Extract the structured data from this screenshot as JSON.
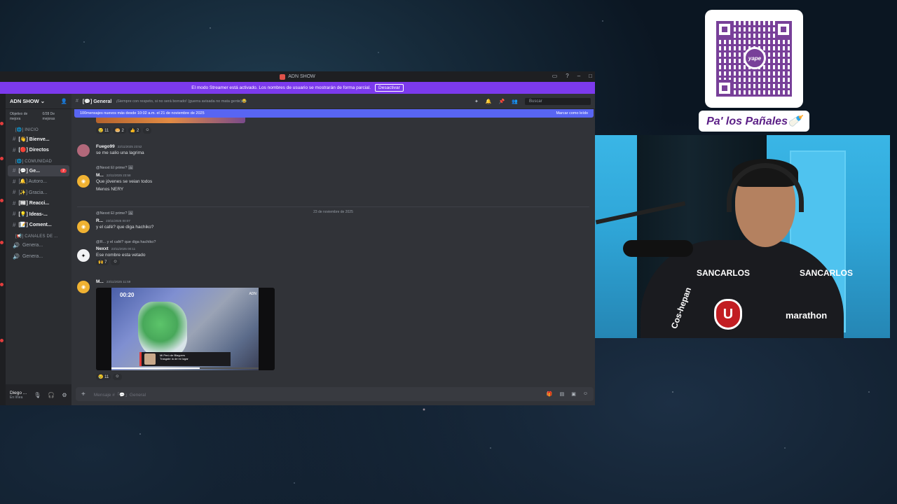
{
  "window": {
    "title": "ADN SHOW",
    "streamer_notice": "El modo Streamer está activado. Los nombres de usuario se mostrarán de forma parcial.",
    "streamer_button": "Desactivar"
  },
  "server": {
    "name": "ADN SHOW",
    "boost_label": "Objetivo de mejora",
    "boost_progress": "0/28 De mejoras"
  },
  "channels": [
    {
      "type": "category",
      "label": "[🌐] INICIO"
    },
    {
      "type": "channel",
      "label": "[👋] Bienve...",
      "bold": true
    },
    {
      "type": "channel",
      "label": "[🔴] Directos",
      "bold": true
    },
    {
      "type": "category",
      "label": "[🌐] COMUNIDAD"
    },
    {
      "type": "channel",
      "label": "[💬] Ge...",
      "active": true,
      "badge": "2"
    },
    {
      "type": "channel",
      "label": "[🔔] Autoro..."
    },
    {
      "type": "channel",
      "label": "[✨] Gracia..."
    },
    {
      "type": "channel",
      "label": "[📰] Reacci...",
      "bold": true
    },
    {
      "type": "channel",
      "label": "[💡] Ideas-...",
      "bold": true
    },
    {
      "type": "channel",
      "label": "[📝] Coment...",
      "bold": true
    },
    {
      "type": "category",
      "label": "[📢] CANALES DE ..."
    },
    {
      "type": "voice",
      "label": "Genera..."
    },
    {
      "type": "voice",
      "label": "Genera..."
    }
  ],
  "user": {
    "name": "Diego ...",
    "status": "En línea"
  },
  "chat": {
    "channel_name": "[💬] General",
    "topic": "¡Siempre con respeto, si no será borrado! (guerra avisada no mata gente)😂",
    "search_placeholder": "Buscar",
    "new_messages": "100mensajes nuevos más desde 10:02 a.m. el 21 de noviembre de 2025",
    "mark_read": "Marcar como leído",
    "composer_placeholder": "Mensaje #「💬」General",
    "date_divider": "23 de noviembre de 2025"
  },
  "messages": {
    "top_reacts": [
      "😢 11",
      "🥯 2",
      "👍 2",
      "☺"
    ],
    "m1": {
      "author": "Fuego99",
      "time": "22/11/2025 23:52",
      "text": "se me salio una lagrima"
    },
    "m2": {
      "reply": "@Nexxt El prime? 🖼",
      "author": "M...",
      "time": "22/11/2025 23:58",
      "line1": "Que jóvenes se veian todos",
      "line2": "Menos NERY"
    },
    "m3": {
      "reply": "@Nexxt El prime? 🖼",
      "author": "R...",
      "time": "23/11/2025 00:07",
      "text": "y el café? que diga hachiko?"
    },
    "m4": {
      "reply": "@R... y el café? que diga hachiko?",
      "author": "Nexxt",
      "time": "23/11/2025 00:11",
      "text": "Ese nombre esta vetado",
      "react": "🙌 7"
    },
    "m5": {
      "author": "M...",
      "time": "23/11/2025 11:59",
      "video_time": "00:20",
      "video_logo": "ADN",
      "popup_title": "Mi Perú de Blaypers",
      "popup_sub": "Trasgate la de mi lugar",
      "react": "😢 11"
    }
  },
  "overlay": {
    "qr_brand": "yape",
    "panales_text": "Pa' los Pañales🍼"
  },
  "webcam": {
    "sponsor_left": "SANCARLOS",
    "sponsor_right": "SANCARLOS",
    "chest_text": "marathon",
    "sleeve_text": "Cos-hepan",
    "crest": "U"
  }
}
